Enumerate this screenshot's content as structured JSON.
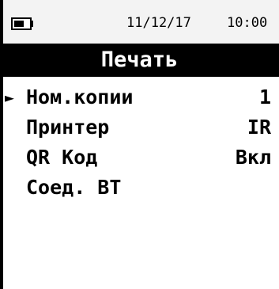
{
  "status_bar": {
    "battery_icon": "battery-icon",
    "date": "11/12/17",
    "time": "10:00"
  },
  "title": "Печать",
  "menu": {
    "cursor": "►",
    "items": [
      {
        "label": "Ном.копии",
        "value": "1"
      },
      {
        "label": "Принтер",
        "value": "IR"
      },
      {
        "label": "QR Код",
        "value": "Вкл"
      },
      {
        "label": "Соед. BT",
        "value": ""
      }
    ]
  },
  "colors": {
    "background": "#ffffff",
    "title_bar": "#000000",
    "title_text": "#ffffff",
    "status_bar": "#f3f3f3"
  }
}
